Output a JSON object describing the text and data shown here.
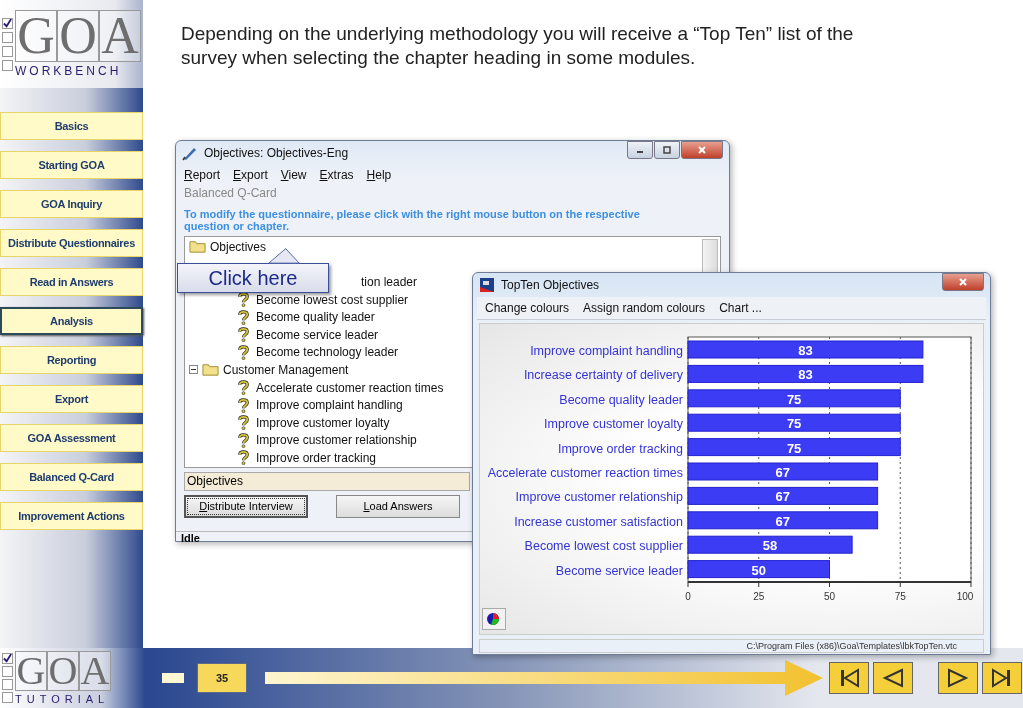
{
  "logo": {
    "letters": "GOA",
    "subtitle": "WORKBENCH",
    "checks": [
      true,
      false,
      false,
      false
    ]
  },
  "nav": [
    {
      "label": "Basics",
      "selected": false
    },
    {
      "label": "Starting GOA",
      "selected": false
    },
    {
      "label": "GOA Inquiry",
      "selected": false
    },
    {
      "label": "Distribute Questionnaires",
      "selected": false
    },
    {
      "label": "Read in Answers",
      "selected": false
    },
    {
      "label": "Analysis",
      "selected": true
    },
    {
      "label": "Reporting",
      "selected": false
    },
    {
      "label": "Export",
      "selected": false
    },
    {
      "label": "GOA Assessment",
      "selected": false
    },
    {
      "label": "Balanced Q-Card",
      "selected": false
    },
    {
      "label": "Improvement Actions",
      "selected": false
    }
  ],
  "intro": "Depending on the underlying methodology you will receive a “Top Ten” list of the survey when selecting the chapter heading in some modules.",
  "objectives_window": {
    "title": "Objectives: Objectives-Eng",
    "menu": [
      "Report",
      "Export",
      "View",
      "Extras",
      "Help"
    ],
    "subtitle": "Balanced Q-Card",
    "hint": "To modify the questionnaire, please click with the right mouse button on the respective question or chapter.",
    "tree": [
      {
        "kind": "folder",
        "label": "Objectives",
        "children": [
          {
            "kind": "folder",
            "expanded": true,
            "children": [
              {
                "label": "tion leader",
                "covered": true
              },
              {
                "kind": "question",
                "label": "Become lowest cost supplier"
              },
              {
                "kind": "question",
                "label": "Become quality leader"
              },
              {
                "kind": "question",
                "label": "Become service leader"
              },
              {
                "kind": "question",
                "label": "Become technology leader"
              }
            ]
          },
          {
            "kind": "folder",
            "label": "Customer Management",
            "expanded": true,
            "children": [
              {
                "kind": "question",
                "label": "Accelerate customer reaction times"
              },
              {
                "kind": "question",
                "label": "Improve complaint handling"
              },
              {
                "kind": "question",
                "label": "Improve customer loyalty"
              },
              {
                "kind": "question",
                "label": "Improve customer relationship"
              },
              {
                "kind": "question",
                "label": "Improve order tracking"
              }
            ]
          }
        ]
      }
    ],
    "selection": "Objectives",
    "buttons": [
      "Distribute Interview",
      "Load Answers"
    ],
    "status": "Idle"
  },
  "callout": "Click here",
  "topten_window": {
    "title": "TopTen Objectives",
    "menu": [
      "Change colours",
      "Assign random colours",
      "Chart ..."
    ],
    "chart_data": {
      "type": "bar",
      "orientation": "horizontal",
      "categories": [
        "Improve complaint handling",
        "Increase certainty of delivery",
        "Become quality leader",
        "Improve customer loyalty",
        "Improve order tracking",
        "Accelerate customer reaction times",
        "Improve customer relationship",
        "Increase customer satisfaction",
        "Become lowest cost supplier",
        "Become service leader"
      ],
      "series": [
        {
          "color": "#3c3cf5",
          "values": [
            83,
            83,
            75,
            75,
            75,
            67,
            67,
            67,
            58,
            50
          ]
        }
      ],
      "xlim": [
        0,
        100
      ],
      "xticks": [
        0,
        25,
        50,
        75,
        100
      ],
      "grid": true,
      "data_labels": true
    },
    "path": "C:\\Program Files (x86)\\Goa\\Templates\\lbkTopTen.vtc"
  },
  "footer": {
    "logo_letters": "GOA",
    "logo_subtitle": "TUTORIAL",
    "checks": [
      true,
      false,
      false,
      false
    ],
    "page": "35"
  }
}
